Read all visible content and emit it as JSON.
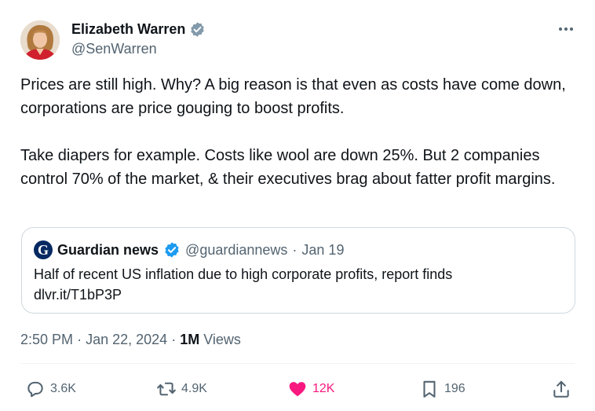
{
  "author": {
    "name": "Elizabeth Warren",
    "handle": "@SenWarren",
    "avatar_icon": "portrait-avatar",
    "verified_badge_color": "#829aab"
  },
  "menu_icon": "more-horizontal-icon",
  "tweet": {
    "paragraph_1": "Prices are still high. Why? A big reason is that even as costs have come down, corporations are price gouging to boost profits.",
    "paragraph_2": "Take diapers for example. Costs like wool are down 25%. But 2 companies control 70% of the market, & their executives brag about fatter profit margins."
  },
  "quoted_tweet": {
    "source_name": "Guardian news",
    "source_handle": "@guardiannews",
    "separator": "·",
    "date": "Jan 19",
    "logo_letter": "G",
    "logo_color": "#052962",
    "verified_badge_color": "#1d9bf0",
    "headline": "Half of recent US inflation due to high corporate profits, report finds",
    "link": "dlvr.it/T1bP3P"
  },
  "meta": {
    "time": "2:50 PM",
    "separator": "·",
    "date": "Jan 22, 2024",
    "separator_2": "·",
    "views_count": "1M",
    "views_label": "Views"
  },
  "actions": {
    "replies": "3.6K",
    "reposts": "4.9K",
    "likes": "12K",
    "bookmarks": "196",
    "like_color": "#f91880",
    "icon_color": "#536471"
  }
}
